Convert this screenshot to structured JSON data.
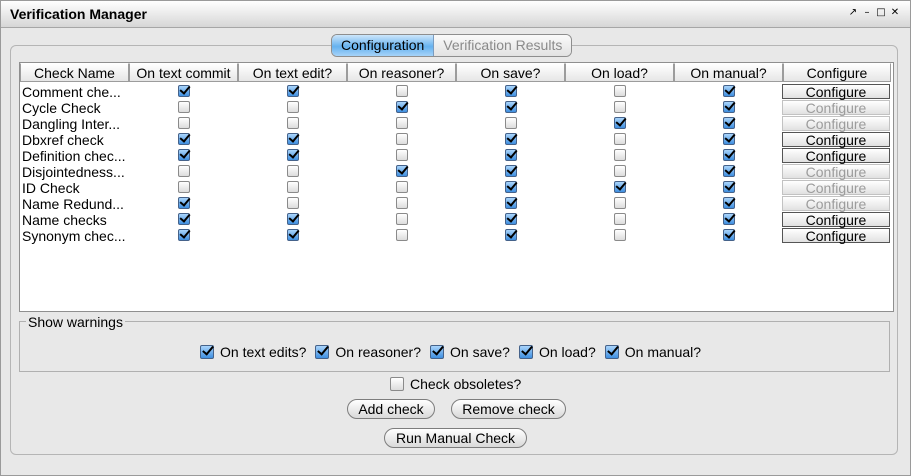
{
  "window": {
    "title": "Verification Manager",
    "controls": [
      "pin-icon",
      "minimize-icon",
      "maximize-icon",
      "close-icon"
    ]
  },
  "tabs": [
    {
      "label": "Configuration",
      "active": true
    },
    {
      "label": "Verification Results",
      "active": false
    }
  ],
  "table": {
    "headers": [
      "Check Name",
      "On text commit",
      "On text edit?",
      "On reasoner?",
      "On save?",
      "On load?",
      "On manual?",
      "Configure"
    ],
    "configure_label": "Configure",
    "rows": [
      {
        "name": "Comment che...",
        "checks": [
          true,
          true,
          false,
          true,
          false,
          true
        ],
        "configure_enabled": true
      },
      {
        "name": "Cycle Check",
        "checks": [
          false,
          false,
          true,
          true,
          false,
          true
        ],
        "configure_enabled": false
      },
      {
        "name": "Dangling Inter...",
        "checks": [
          false,
          false,
          false,
          false,
          true,
          true
        ],
        "configure_enabled": false
      },
      {
        "name": "Dbxref check",
        "checks": [
          true,
          true,
          false,
          true,
          false,
          true
        ],
        "configure_enabled": true
      },
      {
        "name": "Definition chec...",
        "checks": [
          true,
          true,
          false,
          true,
          false,
          true
        ],
        "configure_enabled": true
      },
      {
        "name": "Disjointedness...",
        "checks": [
          false,
          false,
          true,
          true,
          false,
          true
        ],
        "configure_enabled": false
      },
      {
        "name": "ID Check",
        "checks": [
          false,
          false,
          false,
          true,
          true,
          true
        ],
        "configure_enabled": false
      },
      {
        "name": "Name Redund...",
        "checks": [
          true,
          false,
          false,
          true,
          false,
          true
        ],
        "configure_enabled": false
      },
      {
        "name": "Name checks",
        "checks": [
          true,
          true,
          false,
          true,
          false,
          true
        ],
        "configure_enabled": true
      },
      {
        "name": "Synonym chec...",
        "checks": [
          true,
          true,
          false,
          true,
          false,
          true
        ],
        "configure_enabled": true
      }
    ]
  },
  "warnings": {
    "legend": "Show warnings",
    "options": [
      {
        "label": "On text edits?",
        "checked": true
      },
      {
        "label": "On reasoner?",
        "checked": true
      },
      {
        "label": "On save?",
        "checked": true
      },
      {
        "label": "On load?",
        "checked": true
      },
      {
        "label": "On manual?",
        "checked": true
      }
    ]
  },
  "obsoletes": {
    "label": "Check obsoletes?",
    "checked": false
  },
  "buttons": {
    "add": "Add check",
    "remove": "Remove check",
    "run": "Run Manual Check"
  }
}
